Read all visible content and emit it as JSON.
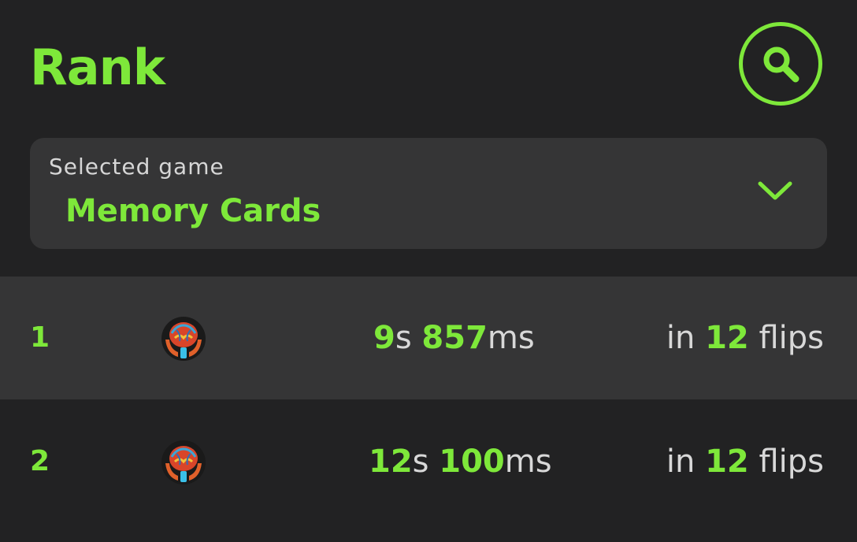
{
  "header": {
    "title": "Rank",
    "search_icon": "search-icon"
  },
  "selector": {
    "label": "Selected game",
    "value": "Memory Cards",
    "chevron_icon": "chevron-down-icon"
  },
  "rows": [
    {
      "rank": "1",
      "avatar_icon": "brain-avatar",
      "seconds": "9",
      "seconds_unit": "s",
      "ms": "857",
      "ms_unit": "ms",
      "flips_prefix": "in",
      "flips": "12",
      "flips_suffix": "flips"
    },
    {
      "rank": "2",
      "avatar_icon": "brain-avatar",
      "seconds": "12",
      "seconds_unit": "s",
      "ms": "100",
      "ms_unit": "ms",
      "flips_prefix": "in",
      "flips": "12",
      "flips_suffix": "flips"
    }
  ],
  "colors": {
    "background": "#222223",
    "surface": "#353536",
    "accent": "#7ee83a",
    "text": "#d8d8d8"
  }
}
